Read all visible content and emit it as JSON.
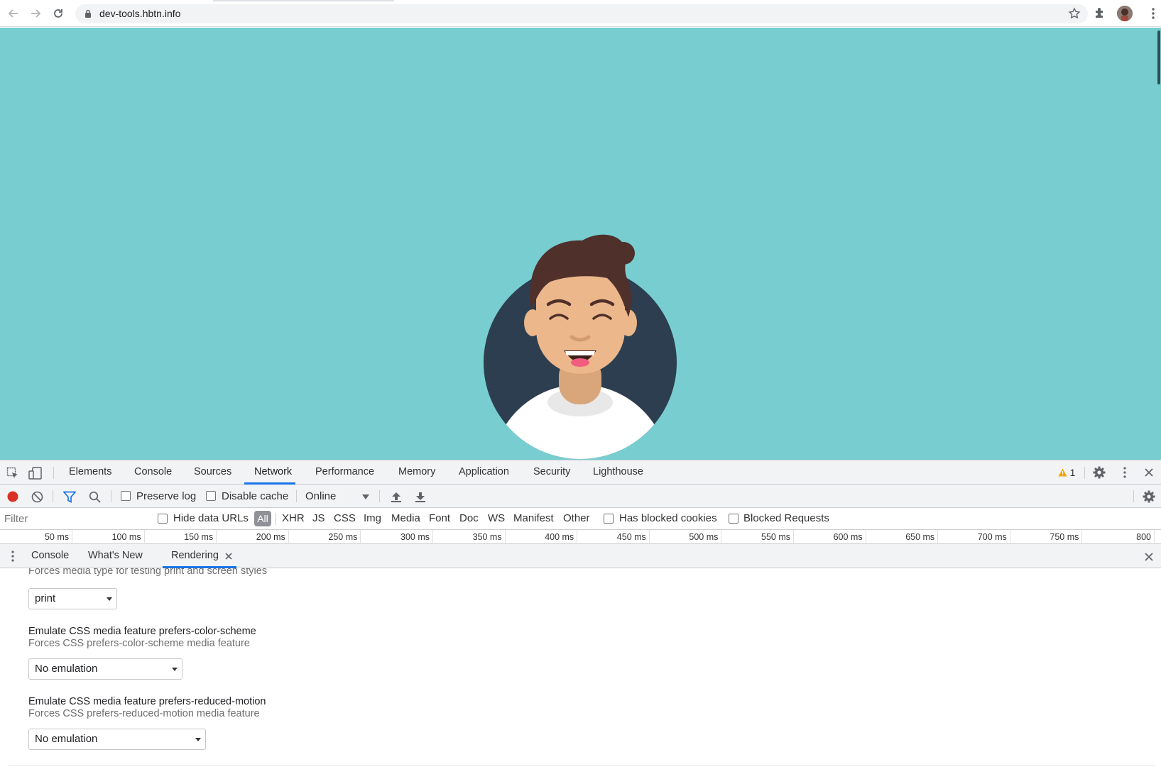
{
  "browser": {
    "url": "dev-tools.hbtn.info"
  },
  "devtools": {
    "tabs": [
      "Elements",
      "Console",
      "Sources",
      "Network",
      "Performance",
      "Memory",
      "Application",
      "Security",
      "Lighthouse"
    ],
    "active_tab": "Network",
    "warning_count": "1",
    "network": {
      "preserve_log": "Preserve log",
      "disable_cache": "Disable cache",
      "throttling": "Online",
      "filter_placeholder": "Filter",
      "hide_data_urls": "Hide data URLs",
      "types": [
        "All",
        "XHR",
        "JS",
        "CSS",
        "Img",
        "Media",
        "Font",
        "Doc",
        "WS",
        "Manifest",
        "Other"
      ],
      "has_blocked_cookies": "Has blocked cookies",
      "blocked_requests": "Blocked Requests",
      "timeline_ticks": [
        "50 ms",
        "100 ms",
        "150 ms",
        "200 ms",
        "250 ms",
        "300 ms",
        "350 ms",
        "400 ms",
        "450 ms",
        "500 ms",
        "550 ms",
        "600 ms",
        "650 ms",
        "700 ms",
        "750 ms",
        "800 ms"
      ]
    },
    "drawer": {
      "tabs": [
        "Console",
        "What's New",
        "Rendering"
      ],
      "active_tab": "Rendering",
      "rendering": {
        "media_desc": "Forces media type for testing print and screen styles",
        "media_value": "print",
        "color_scheme_title": "Emulate CSS media feature prefers-color-scheme",
        "color_scheme_desc": "Forces CSS prefers-color-scheme media feature",
        "color_scheme_value": "No emulation",
        "reduced_motion_title": "Emulate CSS media feature prefers-reduced-motion",
        "reduced_motion_desc": "Forces CSS prefers-reduced-motion media feature",
        "reduced_motion_value": "No emulation"
      }
    }
  },
  "colors": {
    "page_background": "#78cdd0",
    "avatar_circle": "#2c3e50",
    "skin": "#ecb78b",
    "hair": "#4f302a",
    "accent_blue": "#1a73e8",
    "record_red": "#d93025"
  }
}
